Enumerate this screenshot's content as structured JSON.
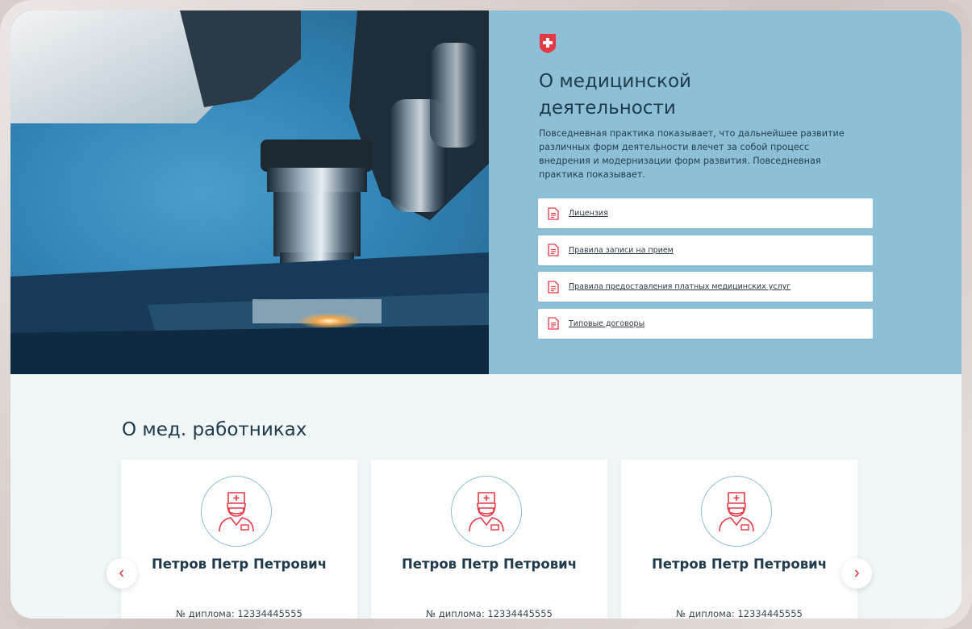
{
  "hero": {
    "title": "О медицинской деятельности",
    "description": "Повседневная практика показывает, что дальнейшее развитие различных форм деятельности влечет за собой процесс внедрения и модернизации форм развития. Повседневная практика показывает.",
    "documents": [
      {
        "label": "Лицензия",
        "icon": "document-icon"
      },
      {
        "label": "Правила записи на прием",
        "icon": "document-icon"
      },
      {
        "label": "Правила предоставления платных медицинских услуг",
        "icon": "document-icon"
      },
      {
        "label": "Типовые договоры",
        "icon": "document-icon"
      }
    ]
  },
  "team": {
    "title": "О мед. работниках",
    "cards": [
      {
        "name": "Петров Петр Петрович",
        "diploma": "№ диплома: 12334445555",
        "icon": "doctor-icon"
      },
      {
        "name": "Петров Петр Петрович",
        "diploma": "№ диплома: 12334445555",
        "icon": "doctor-icon"
      },
      {
        "name": "Петров Петр Петрович",
        "diploma": "№ диплома: 12334445555",
        "icon": "doctor-icon"
      }
    ],
    "prev_icon": "chevron-left-icon",
    "next_icon": "chevron-right-icon"
  },
  "colors": {
    "accent": "#e63946",
    "panel": "#8dc0d6",
    "heading": "#1f3a4a",
    "section_bg": "#f1f7f9"
  }
}
